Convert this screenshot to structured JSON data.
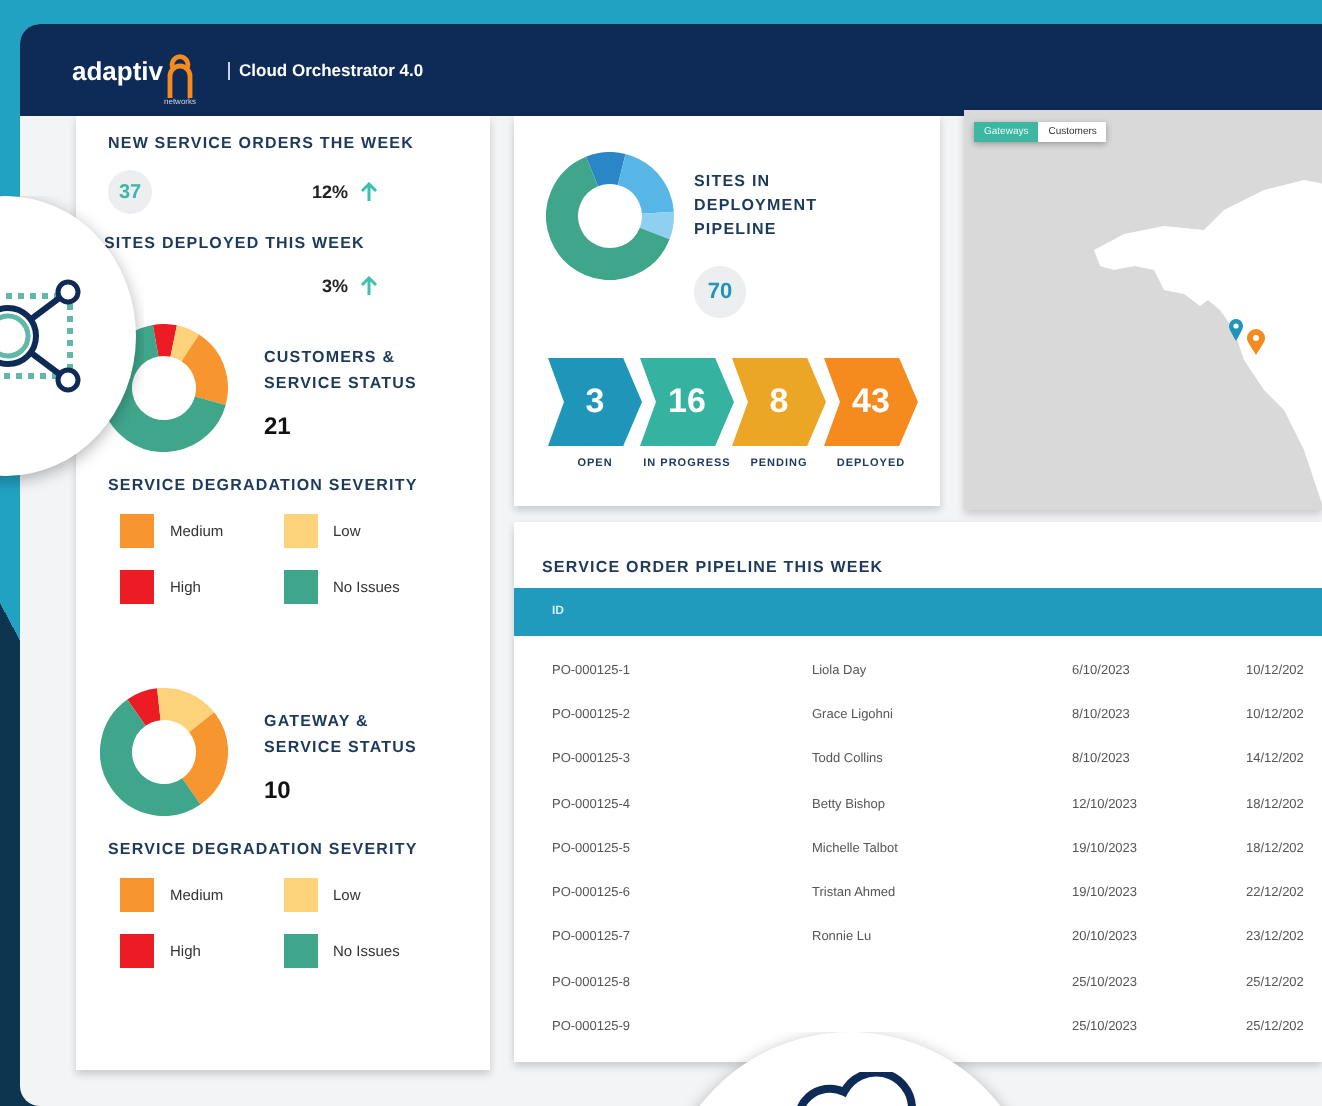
{
  "header": {
    "logo_text": "adaptiv",
    "logo_subtext": "networks",
    "title": "Cloud Orchestrator 4.0"
  },
  "summary": {
    "new_orders": {
      "title": "NEW SERVICE ORDERS THE WEEK",
      "value": "37",
      "change": "12%",
      "rising": true
    },
    "sites_deployed": {
      "title": "SITES DEPLOYED THIS WEEK",
      "change": "3%",
      "rising": true
    }
  },
  "status_panels": [
    {
      "title": "CUSTOMERS & SERVICE STATUS",
      "count": "21",
      "legend_title": "SERVICE DEGRADATION SEVERITY",
      "legend": [
        {
          "label": "Medium",
          "color": "#f7952f"
        },
        {
          "label": "Low",
          "color": "#fcd27a"
        },
        {
          "label": "High",
          "color": "#ec1c24"
        },
        {
          "label": "No Issues",
          "color": "#3fa68c"
        }
      ]
    },
    {
      "title": "GATEWAY & SERVICE STATUS",
      "count": "10",
      "legend_title": "SERVICE DEGRADATION SEVERITY",
      "legend": [
        {
          "label": "Medium",
          "color": "#f7952f"
        },
        {
          "label": "Low",
          "color": "#fcd27a"
        },
        {
          "label": "High",
          "color": "#ec1c24"
        },
        {
          "label": "No Issues",
          "color": "#3fa68c"
        }
      ]
    }
  ],
  "pipeline": {
    "title": "SITES IN DEPLOYMENT PIPELINE",
    "total": "70",
    "stages": [
      {
        "value": "3",
        "label": "OPEN",
        "color": "#1e95b9"
      },
      {
        "value": "16",
        "label": "IN PROGRESS",
        "color": "#36b3a0"
      },
      {
        "value": "8",
        "label": "PENDING",
        "color": "#eca625"
      },
      {
        "value": "43",
        "label": "DEPLOYED",
        "color": "#f58a1f"
      }
    ]
  },
  "map": {
    "tabs": [
      {
        "label": "Gateways",
        "selected": true
      },
      {
        "label": "Customers",
        "selected": false
      }
    ]
  },
  "orders": {
    "title": "SERVICE ORDER PIPELINE THIS WEEK",
    "columns": [
      "ID"
    ],
    "rows": [
      {
        "id": "PO-000125-1",
        "column_2": "Liola Day",
        "column_3": "6/10/2023",
        "column_4": "10/12/202"
      },
      {
        "id": "PO-000125-2",
        "column_2": "Grace Ligohni",
        "column_3": "8/10/2023",
        "column_4": "10/12/202"
      },
      {
        "id": "PO-000125-3",
        "column_2": "Todd Collins",
        "column_3": "8/10/2023",
        "column_4": "14/12/202"
      },
      {
        "id": "PO-000125-4",
        "column_2": "Betty Bishop",
        "column_3": "12/10/2023",
        "column_4": "18/12/202"
      },
      {
        "id": "PO-000125-5",
        "column_2": "Michelle Talbot",
        "column_3": "19/10/2023",
        "column_4": "18/12/202"
      },
      {
        "id": "PO-000125-6",
        "column_2": "Tristan Ahmed",
        "column_3": "19/10/2023",
        "column_4": "22/12/202"
      },
      {
        "id": "PO-000125-7",
        "column_2": "Ronnie Lu",
        "column_3": "20/10/2023",
        "column_4": "23/12/202"
      },
      {
        "id": "PO-000125-8",
        "column_3": "25/10/2023",
        "column_4": "25/12/202"
      },
      {
        "id": "PO-000125-9",
        "column_3": "25/10/2023",
        "column_4": "25/12/202"
      }
    ]
  }
}
